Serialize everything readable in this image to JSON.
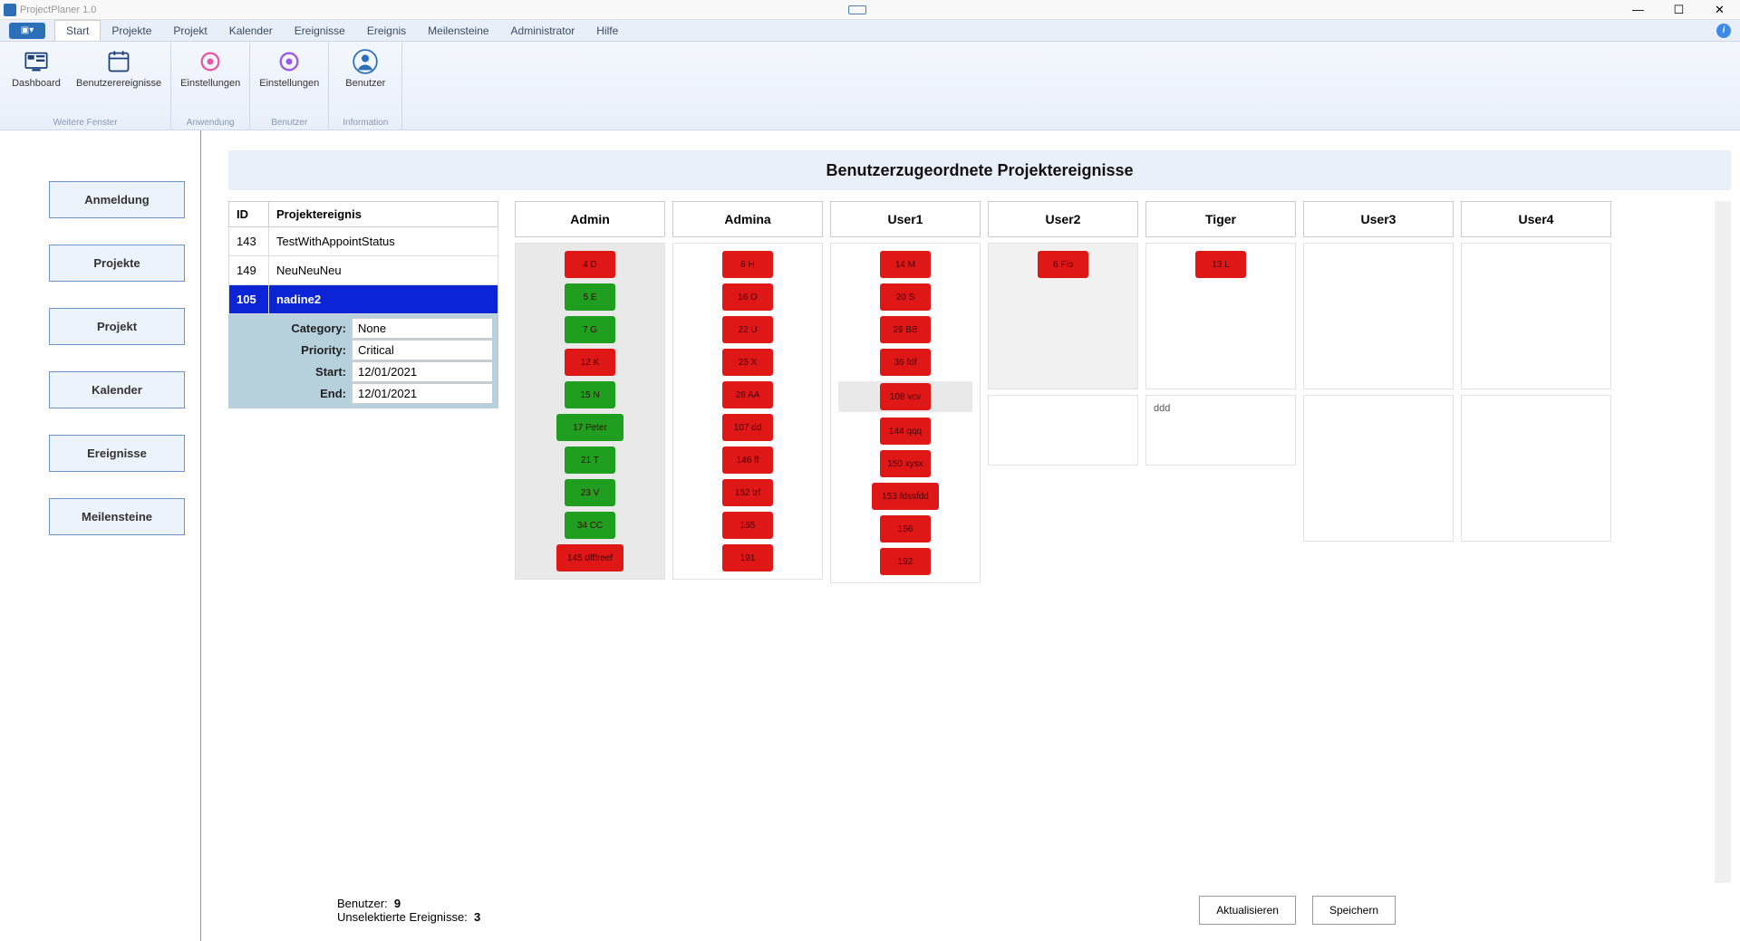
{
  "app": {
    "title": "ProjectPlaner 1.0"
  },
  "menu": {
    "items": [
      "Start",
      "Projekte",
      "Projekt",
      "Kalender",
      "Ereignisse",
      "Ereignis",
      "Meilensteine",
      "Administrator",
      "Hilfe"
    ],
    "active": 0
  },
  "ribbon": {
    "groups": [
      {
        "caption": "Weitere Fenster",
        "buttons": [
          {
            "label": "Dashboard",
            "icon": "dashboard-icon"
          },
          {
            "label": "Benutzerereignisse",
            "icon": "calendar-icon"
          }
        ]
      },
      {
        "caption": "Anwendung",
        "buttons": [
          {
            "label": "Einstellungen",
            "icon": "gear-pink-icon"
          }
        ]
      },
      {
        "caption": "Benutzer",
        "buttons": [
          {
            "label": "Einstellungen",
            "icon": "gear-purple-icon"
          }
        ]
      },
      {
        "caption": "Information",
        "buttons": [
          {
            "label": "Benutzer",
            "icon": "user-icon"
          }
        ]
      }
    ]
  },
  "sidebar": {
    "items": [
      "Anmeldung",
      "Projekte",
      "Projekt",
      "Kalender",
      "Ereignisse",
      "Meilensteine"
    ]
  },
  "main": {
    "title": "Benutzerzugeordnete Projektereignisse",
    "event_table": {
      "headers": {
        "id": "ID",
        "name": "Projektereignis"
      },
      "rows": [
        {
          "id": "143",
          "name": "TestWithAppointStatus"
        },
        {
          "id": "149",
          "name": "NeuNeuNeu"
        },
        {
          "id": "105",
          "name": "nadine2",
          "selected": true
        }
      ],
      "details": {
        "category_label": "Category:",
        "category": "None",
        "priority_label": "Priority:",
        "priority": "Critical",
        "start_label": "Start:",
        "start": "12/01/2021",
        "end_label": "End:",
        "end": "12/01/2021"
      }
    },
    "users": [
      {
        "name": "Admin",
        "slots": [
          {
            "highlight": true,
            "chips": [
              {
                "color": "red",
                "text": "4   D"
              },
              {
                "color": "green",
                "text": "5   E"
              },
              {
                "color": "green",
                "text": "7   G"
              },
              {
                "color": "red",
                "text": "12   K"
              },
              {
                "color": "green",
                "text": "15   N"
              },
              {
                "color": "green",
                "text": "17   Peter",
                "wide": true
              },
              {
                "color": "green",
                "text": "21   T"
              },
              {
                "color": "green",
                "text": "23   V"
              },
              {
                "color": "green",
                "text": "34   CC"
              },
              {
                "color": "red",
                "text": "145   dfffreef",
                "wide": true
              }
            ]
          }
        ]
      },
      {
        "name": "Admina",
        "slots": [
          {
            "chips": [
              {
                "color": "red",
                "text": "8   H"
              },
              {
                "color": "red",
                "text": "16   O"
              },
              {
                "color": "red",
                "text": "22   U"
              },
              {
                "color": "red",
                "text": "25   X"
              },
              {
                "color": "red",
                "text": "28   AA"
              },
              {
                "color": "red",
                "text": "107   dd"
              },
              {
                "color": "red",
                "text": "146   ff"
              },
              {
                "color": "red",
                "text": "152   trf"
              },
              {
                "color": "red",
                "text": "155"
              },
              {
                "color": "red",
                "text": "191"
              }
            ]
          }
        ]
      },
      {
        "name": "User1",
        "slots": [
          {
            "chips": [
              {
                "color": "red",
                "text": "14   M"
              },
              {
                "color": "red",
                "text": "20   S"
              },
              {
                "color": "red",
                "text": "29   BB"
              },
              {
                "color": "red",
                "text": "36   fdf"
              },
              {
                "color": "red",
                "text": "108   vcv",
                "highlight": true
              },
              {
                "color": "red",
                "text": "144   qqq"
              },
              {
                "color": "red",
                "text": "150   xysx"
              },
              {
                "color": "red",
                "text": "153   fdssfdd",
                "wide": true
              },
              {
                "color": "red",
                "text": "156"
              },
              {
                "color": "red",
                "text": "192"
              }
            ]
          }
        ]
      },
      {
        "name": "User2",
        "slots": [
          {
            "alt": true,
            "chips": [
              {
                "color": "red",
                "text": "6   Flo"
              }
            ]
          },
          {
            "note": ""
          }
        ]
      },
      {
        "name": "Tiger",
        "slots": [
          {
            "chips": [
              {
                "color": "red",
                "text": "13   L"
              }
            ]
          },
          {
            "note": "ddd"
          }
        ]
      },
      {
        "name": "User3",
        "slots": [
          {},
          {}
        ]
      },
      {
        "name": "User4",
        "slots": [
          {},
          {}
        ]
      }
    ]
  },
  "footer": {
    "user_label": "Benutzer:",
    "user_count": "9",
    "unselected_label": "Unselektierte Ereignisse:",
    "unselected_count": "3",
    "refresh": "Aktualisieren",
    "save": "Speichern"
  }
}
